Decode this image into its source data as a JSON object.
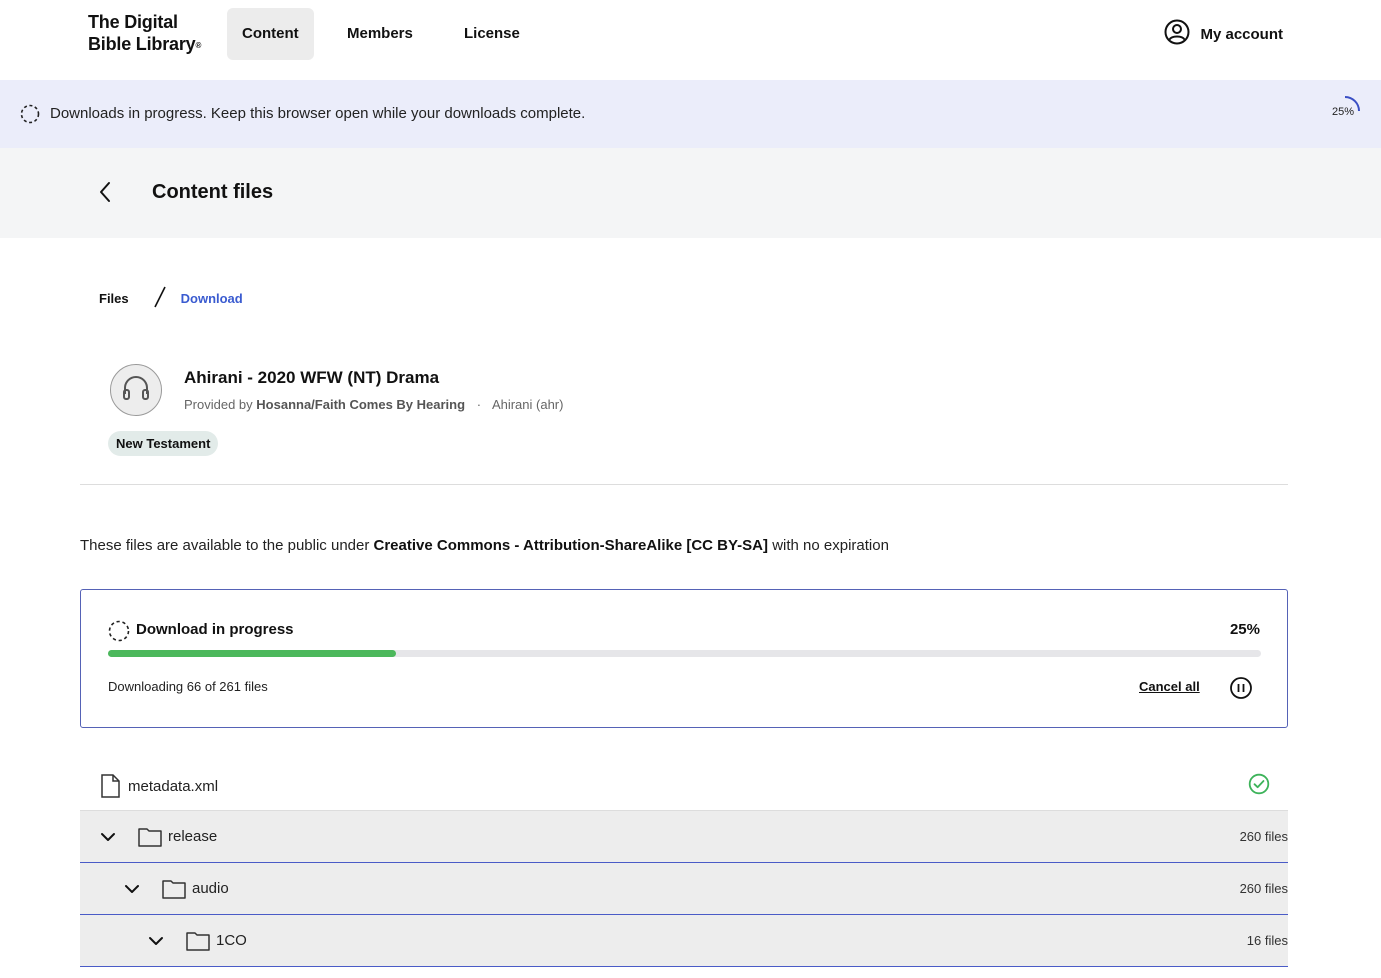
{
  "nav": {
    "logo_line1": "The Digital",
    "logo_line2": "Bible Library",
    "logo_mark": "®",
    "items": [
      {
        "label": "Content",
        "active": true
      },
      {
        "label": "Members",
        "active": false
      },
      {
        "label": "License",
        "active": false
      }
    ],
    "account_label": "My account",
    "account_icon": "user-circle-icon"
  },
  "banner": {
    "message": "Downloads in progress. Keep this browser open while your downloads complete.",
    "percent_label": "25%",
    "progress": 0.25,
    "icon": "spinner-icon"
  },
  "page": {
    "title": "Content files",
    "back_icon": "chevron-left-icon"
  },
  "breadcrumb": {
    "files": "Files",
    "separator": "/",
    "current": "Download"
  },
  "item": {
    "icon": "headphones-icon",
    "title": "Ahirani - 2020 WFW (NT) Drama",
    "provided_by_prefix": "Provided by",
    "provider": "Hosanna/Faith Comes By Hearing",
    "dot": "·",
    "language": "Ahirani (ahr)",
    "tag": "New Testament"
  },
  "license": {
    "prefix": "These files are available to the public under",
    "name": "Creative Commons - Attribution-ShareAlike [CC BY-SA]",
    "suffix": "with no expiration"
  },
  "download": {
    "title": "Download in progress",
    "percent_label": "25%",
    "progress": 0.25,
    "status": "Downloading 66 of 261 files",
    "cancel_label": "Cancel all",
    "pause_icon": "pause-circle-icon",
    "colors": {
      "fill": "#4cb85c",
      "track": "#e6e6e9",
      "border": "#5562b6"
    }
  },
  "files": [
    {
      "type": "file",
      "name": "metadata.xml",
      "status_icon": "check-circle-icon",
      "depth": 0
    },
    {
      "type": "folder",
      "name": "release",
      "count": "260 files",
      "depth": 0
    },
    {
      "type": "folder",
      "name": "audio",
      "count": "260 files",
      "depth": 1
    },
    {
      "type": "folder",
      "name": "1CO",
      "count": "16 files",
      "depth": 2
    }
  ]
}
